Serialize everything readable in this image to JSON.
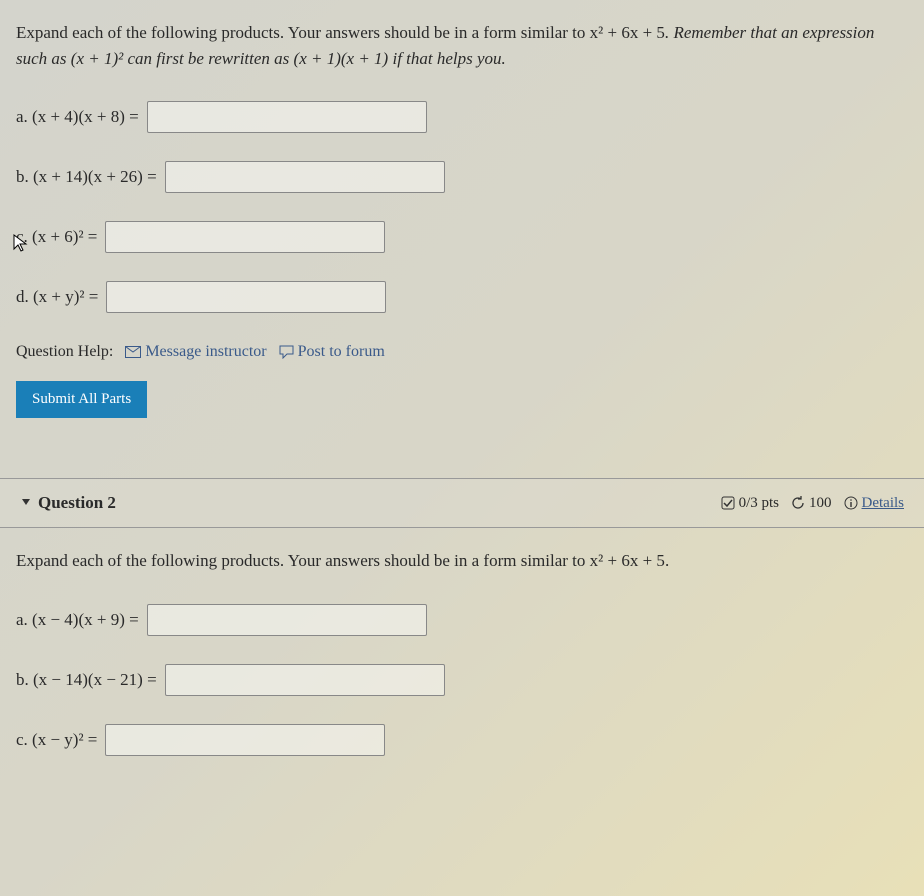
{
  "q1": {
    "instructions_p1": "Expand each of the following products. Your answers should be in a form similar to ",
    "instructions_example1": "x² + 6x + 5",
    "instructions_p2": ". Remember that an expression such as ",
    "instructions_example2": "(x + 1)²",
    "instructions_p3": " can first be rewritten as ",
    "instructions_example3": "(x + 1)(x + 1)",
    "instructions_p4": " if that helps you.",
    "parts": {
      "a": "a. (x + 4)(x + 8) =",
      "b": "b. (x + 14)(x + 26) =",
      "c": "c. (x + 6)² =",
      "d": "d. (x + y)² ="
    },
    "help_label": "Question Help:",
    "help_message": "Message instructor",
    "help_forum": "Post to forum",
    "submit_label": "Submit All Parts"
  },
  "q2": {
    "title": "Question 2",
    "pts": "0/3 pts",
    "retries": "100",
    "details": "Details",
    "instructions_p1": "Expand each of the following products. Your answers should be in a form similar to ",
    "instructions_example1": "x² + 6x + 5",
    "instructions_p2": ".",
    "parts": {
      "a": "a. (x − 4)(x + 9) =",
      "b": "b. (x − 14)(x − 21) =",
      "c": "c. (x − y)² ="
    }
  }
}
